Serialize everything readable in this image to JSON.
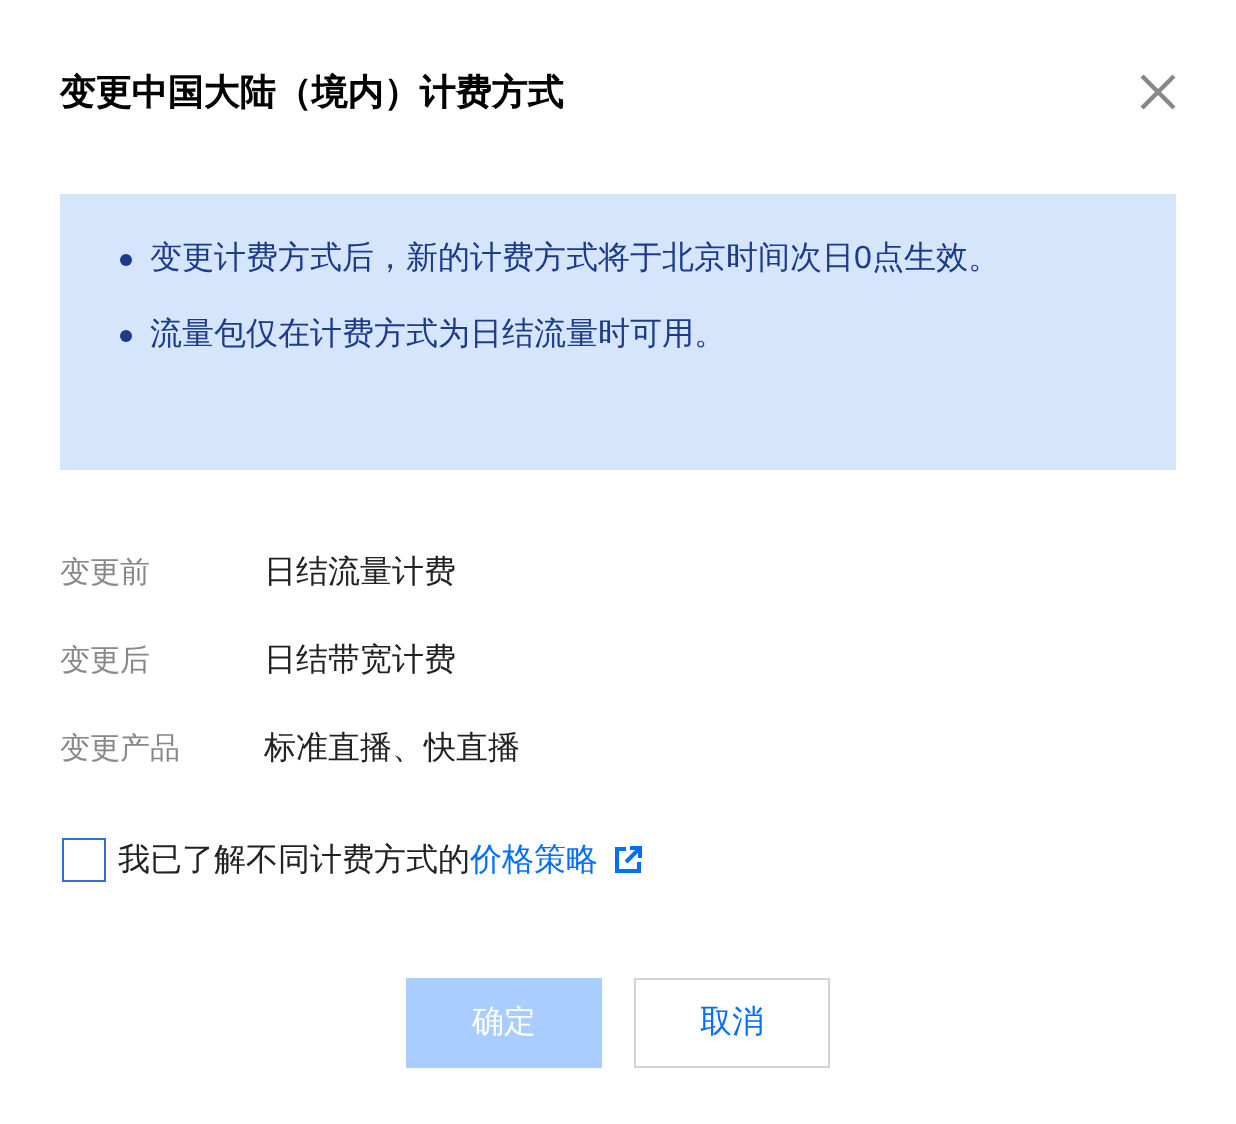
{
  "dialog": {
    "title": "变更中国大陆（境内）计费方式"
  },
  "notices": [
    "变更计费方式后，新的计费方式将于北京时间次日0点生效。",
    "流量包仅在计费方式为日结流量时可用。"
  ],
  "fields": [
    {
      "label": "变更前",
      "value": "日结流量计费"
    },
    {
      "label": "变更后",
      "value": "日结带宽计费"
    },
    {
      "label": "变更产品",
      "value": "标准直播、快直播"
    }
  ],
  "agreement": {
    "checked": false,
    "text": "我已了解不同计费方式的",
    "link": "价格策略"
  },
  "buttons": [
    {
      "label": "确定",
      "kind": "primary",
      "disabled": true
    },
    {
      "label": "取消",
      "kind": "secondary",
      "disabled": false
    }
  ]
}
